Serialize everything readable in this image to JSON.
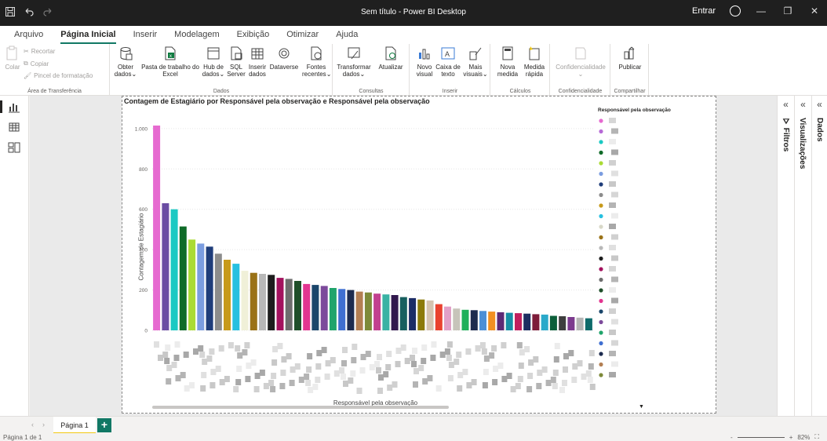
{
  "titlebar": {
    "title": "Sem título - Power BI Desktop",
    "signin": "Entrar"
  },
  "menu": {
    "tabs": [
      "Arquivo",
      "Página Inicial",
      "Inserir",
      "Modelagem",
      "Exibição",
      "Otimizar",
      "Ajuda"
    ],
    "active": "Página Inicial"
  },
  "ribbon": {
    "clipboard": {
      "colar": "Colar",
      "recortar": "Recortar",
      "copiar": "Copiar",
      "pincel": "Pincel de formatação",
      "group": "Área de Transferência"
    },
    "dados": {
      "obter1": "Obter",
      "obter2": "dados",
      "excel1": "Pasta de trabalho do",
      "excel2": "Excel",
      "hub1": "Hub de",
      "hub2": "dados",
      "sql1": "SQL",
      "sql2": "Server",
      "inserir1": "Inserir",
      "inserir2": "dados",
      "dataverse": "Dataverse",
      "fontes1": "Fontes",
      "fontes2": "recentes",
      "group": "Dados"
    },
    "consultas": {
      "transformar1": "Transformar",
      "transformar2": "dados",
      "atualizar": "Atualizar",
      "group": "Consultas"
    },
    "inserir": {
      "novo1": "Novo",
      "novo2": "visual",
      "caixa1": "Caixa de",
      "caixa2": "texto",
      "mais1": "Mais",
      "mais2": "visuais",
      "group": "Inserir"
    },
    "calculos": {
      "nova1": "Nova",
      "nova2": "medida",
      "rapida1": "Medida",
      "rapida2": "rápida",
      "group": "Cálculos"
    },
    "confid": {
      "label": "Confidencialidade",
      "group": "Confidencialidade"
    },
    "compart": {
      "label": "Publicar",
      "group": "Compartilhar"
    }
  },
  "panes": {
    "filtros": "Filtros",
    "visualizacoes": "Visualizações",
    "dados": "Dados"
  },
  "pagebar": {
    "tab": "Página 1",
    "add": "+"
  },
  "status": {
    "left": "Página 1 de 1",
    "zoom": "82%"
  },
  "chart_data": {
    "type": "bar",
    "title": "Contagem de Estagiário por Responsável pela observação e Responsável pela observação",
    "xlabel": "Responsável pela observação",
    "ylabel": "Contagem de Estagiário",
    "legend_title": "Responsável pela observação",
    "legend_position": "right",
    "ylim": [
      0,
      1050
    ],
    "yticks": [
      "0",
      "200",
      "400",
      "600",
      "800",
      "1.000"
    ],
    "ytick_values": [
      0,
      200,
      400,
      600,
      800,
      1000
    ],
    "grid": true,
    "categories_obscured": true,
    "values": [
      1015,
      630,
      600,
      515,
      450,
      430,
      415,
      380,
      350,
      330,
      295,
      285,
      280,
      275,
      260,
      255,
      245,
      230,
      225,
      220,
      210,
      205,
      200,
      192,
      188,
      182,
      178,
      175,
      165,
      160,
      153,
      148,
      130,
      118,
      108,
      102,
      100,
      96,
      93,
      90,
      87,
      85,
      83,
      80,
      78,
      72,
      70,
      66,
      63,
      60
    ],
    "colors": [
      "#e66ad0",
      "#6b4ca3",
      "#1bc9c3",
      "#0f6b28",
      "#aadb35",
      "#7b9de0",
      "#1f3d7a",
      "#8c8c8c",
      "#c79a1b",
      "#27c0e0",
      "#f0f0d8",
      "#9a7217",
      "#b8b8b8",
      "#1d1d1d",
      "#a3125e",
      "#6e6e6e",
      "#1f4f2a",
      "#e23590",
      "#1a466b",
      "#7c4a9b",
      "#20a46b",
      "#3f6fd1",
      "#1d2b4f",
      "#b37f53",
      "#7d8a3a",
      "#c2408f",
      "#3ab2a4",
      "#32184d",
      "#175f5f",
      "#1c2d66",
      "#8c7a0a",
      "#d5c3b0",
      "#e9422f",
      "#e2a0c7",
      "#c7c4ba",
      "#1eb05a",
      "#1d2b4f",
      "#4c8fd6",
      "#f29022",
      "#5c2a75",
      "#178fa6",
      "#c0205e",
      "#1d2e61",
      "#7d1c3a",
      "#2aa9ca",
      "#0c5f3a",
      "#3e3e3e",
      "#7c3a8e",
      "#b5b5b5",
      "#0f6b6b"
    ],
    "legend_colors": [
      "#e66ad0",
      "#b66ad6",
      "#1bc9c3",
      "#0f6b28",
      "#aadb35",
      "#7b9de0",
      "#1f3d7a",
      "#8c8c8c",
      "#c79a1b",
      "#27c0e0",
      "#d8d8c8",
      "#9a7217",
      "#b8b8b8",
      "#1d1d1d",
      "#a3125e",
      "#6e6e6e",
      "#1f4f2a",
      "#e23590",
      "#1a466b",
      "#7c4a9b",
      "#20a46b",
      "#3f6fd1",
      "#1d2b4f",
      "#b37f53",
      "#7d8a3a"
    ]
  }
}
